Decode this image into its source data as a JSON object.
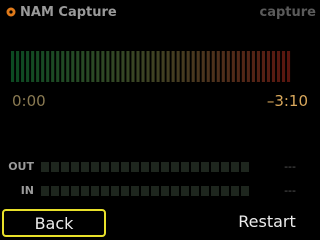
{
  "header": {
    "title": "NAM Capture",
    "mode": "capture",
    "icon": "app-icon",
    "icon_color": "#e07a1a"
  },
  "meter": {
    "segments": 56,
    "color_start": "#0c4a22",
    "color_end": "#5a160f"
  },
  "time": {
    "elapsed": "0:00",
    "remaining": "–3:10"
  },
  "levels": [
    {
      "label": "OUT",
      "value": "---",
      "segments": 21
    },
    {
      "label": "IN",
      "value": "---",
      "segments": 21
    }
  ],
  "buttons": {
    "back": "Back",
    "restart": "Restart"
  },
  "colors": {
    "accent": "#e8e02a",
    "segment_off": "#1e261e"
  }
}
